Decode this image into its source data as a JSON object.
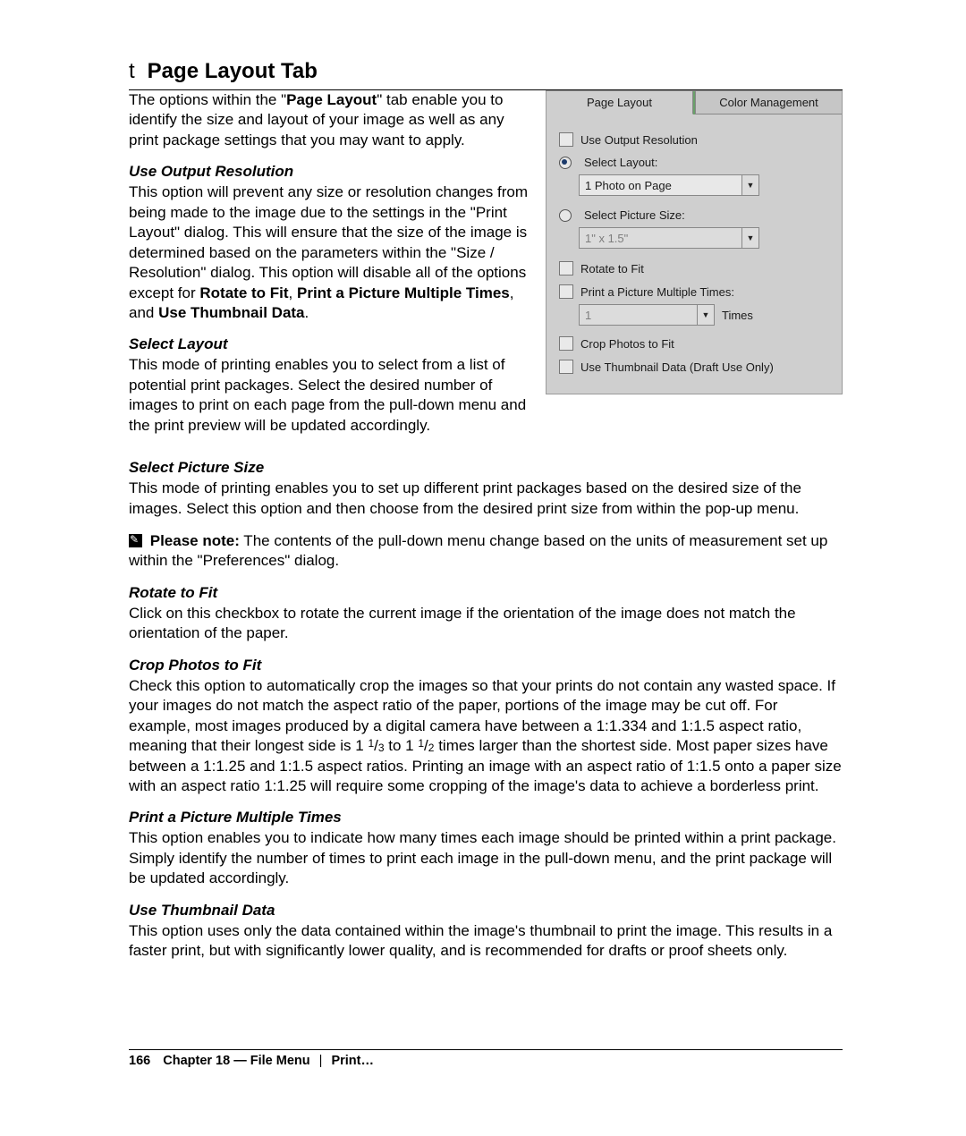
{
  "heading_prefix": "t",
  "heading": "Page Layout Tab",
  "intro_a": "The options within the \"",
  "intro_bold": "Page Layout",
  "intro_b": "\" tab enable you to identify the size and layout of your image as well as any print package settings that you may want to apply.",
  "s1": {
    "h": "Use Output Resolution",
    "p1": "This option will prevent any size or resolution changes from being made to the image due to the settings in the \"Print Layout\" dialog. This will ensure that the size of the image is determined based on the parameters within the \"Size / Resolution\" dialog. This option will disable all of the options except for ",
    "b1": "Rotate to Fit",
    "p2": ", ",
    "b2": "Print a Picture Multiple Times",
    "p3": ", and ",
    "b3": "Use Thumbnail Data",
    "p4": "."
  },
  "s2": {
    "h": "Select Layout",
    "p": "This mode of printing enables you to select from a list of potential print packages. Select the desired number of images to print on each page from the pull-down menu and the print preview will be updated accordingly."
  },
  "s3": {
    "h": "Select Picture Size",
    "p": "This mode of printing enables you to set up different print packages based on the desired size of the images. Select this option and then choose from the desired print size from within the pop-up menu."
  },
  "note": {
    "lead": "Please note:",
    "rest": " The contents of the pull-down menu change based on the units of measurement set up within the \"Preferences\" dialog."
  },
  "s4": {
    "h": "Rotate to Fit",
    "p": "Click on this checkbox to rotate the current image if the orientation of the image does not match the orientation of the paper."
  },
  "s5": {
    "h": "Crop Photos to Fit",
    "p": "Check this option to automatically crop the images so that your prints do not contain any wasted space. If your images do not match the aspect ratio of the paper, portions of the image may be cut off. For example, most images produced by a digital camera have between a 1:1.334 and 1:1.5 aspect ratio, meaning that their longest side is 1 1/3 to 1 1/2 times larger than the shortest side. Most paper sizes have between a 1:1.25 and 1:1.5 aspect ratios. Printing an image with an aspect ratio of 1:1.5 onto a paper size with an aspect ratio 1:1.25 will require some cropping of the image's data to achieve a borderless print."
  },
  "s6": {
    "h": "Print a Picture Multiple Times",
    "p": "This option enables you to indicate how many times each image should be printed within a print package. Simply identify the number of times to print each image in the pull-down menu, and the print package will be updated accordingly."
  },
  "s7": {
    "h": "Use Thumbnail Data",
    "p": "This option uses only the data contained within the image's thumbnail to print the image. This results in a faster print, but with significantly lower quality, and is recommended for drafts or proof sheets only."
  },
  "panel": {
    "tab_active": "Page Layout",
    "tab_inactive": "Color Management",
    "use_output": "Use Output Resolution",
    "sel_layout": "Select Layout:",
    "sel_layout_val": "1 Photo on Page",
    "sel_size": "Select Picture Size:",
    "sel_size_val": "1\" x 1.5\"",
    "rotate": "Rotate to Fit",
    "multi": "Print a Picture Multiple Times:",
    "multi_val": "1",
    "times": "Times",
    "crop": "Crop Photos to Fit",
    "thumb": "Use Thumbnail Data (Draft Use Only)"
  },
  "footer": {
    "page": "166",
    "chapter": "Chapter 18 — File Menu",
    "sub": "Print…"
  }
}
